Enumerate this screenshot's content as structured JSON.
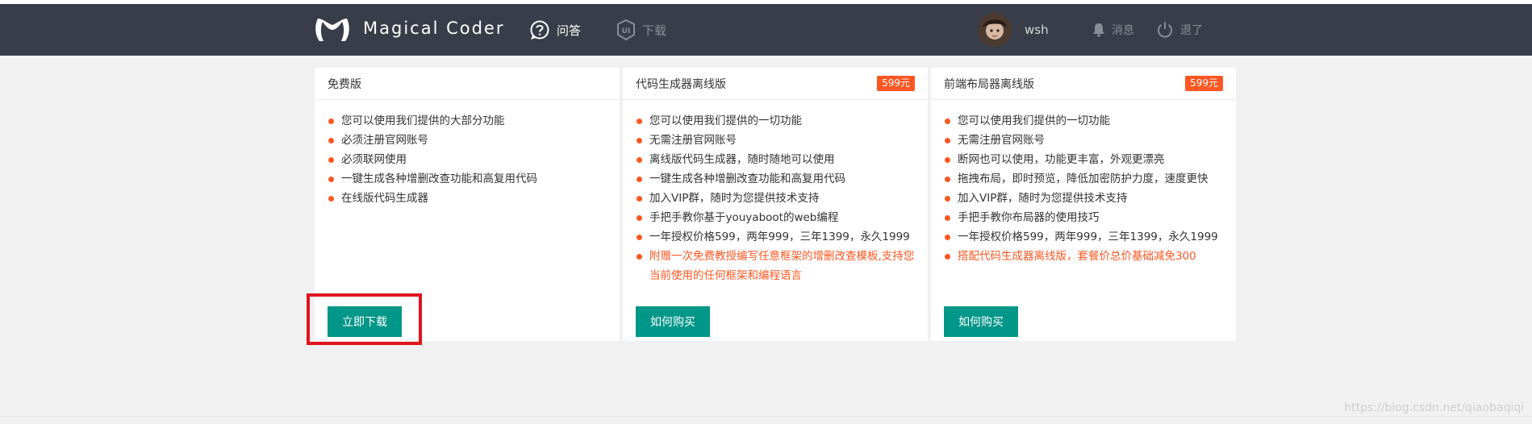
{
  "nav": {
    "brand": "Magical Coder",
    "qa_label": "问答",
    "download_label": "下载",
    "username": "wsh",
    "messages_label": "消息",
    "exit_label": "退了"
  },
  "cards": [
    {
      "title": "免费版",
      "price": "",
      "features": [
        "您可以使用我们提供的大部分功能",
        "必须注册官网账号",
        "必须联网使用",
        "一键生成各种增删改查功能和高复用代码",
        "在线版代码生成器"
      ],
      "highlight": "",
      "button": "立即下载"
    },
    {
      "title": "代码生成器离线版",
      "price": "599元",
      "features": [
        "您可以使用我们提供的一切功能",
        "无需注册官网账号",
        "离线版代码生成器，随时随地可以使用",
        "一键生成各种增删改查功能和高复用代码",
        "加入VIP群，随时为您提供技术支持",
        "手把手教你基于youyaboot的web编程",
        "一年授权价格599，两年999，三年1399，永久1999"
      ],
      "highlight": "附赠一次免费教授编写任意框架的增删改查模板,支持您当前使用的任何框架和编程语言",
      "button": "如何购买"
    },
    {
      "title": "前端布局器离线版",
      "price": "599元",
      "features": [
        "您可以使用我们提供的一切功能",
        "无需注册官网账号",
        "断网也可以使用，功能更丰富，外观更漂亮",
        "拖拽布局，即时预览，降低加密防护力度，速度更快",
        "加入VIP群，随时为您提供技术支持",
        "手把手教你布局器的使用技巧",
        "一年授权价格599，两年999，三年1399，永久1999"
      ],
      "highlight": "搭配代码生成器离线版，套餐价总价基础减免300",
      "button": "如何购买"
    }
  ],
  "watermark": "https://blog.csdn.net/qiaobaqiqi",
  "colors": {
    "navbar": "#393d49",
    "accent": "#ff5722",
    "button": "#009688",
    "annotation": "#e0141e"
  }
}
